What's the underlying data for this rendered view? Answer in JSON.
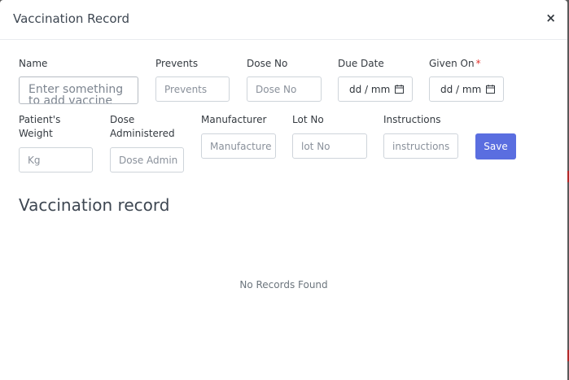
{
  "modal": {
    "title": "Vaccination Record",
    "close_label": "×"
  },
  "form": {
    "name": {
      "label": "Name",
      "placeholder": "Enter something to add vaccine"
    },
    "prevents": {
      "label": "Prevents",
      "placeholder": "Prevents"
    },
    "dose_no": {
      "label": "Dose No",
      "placeholder": "Dose No"
    },
    "due_date": {
      "label": "Due Date",
      "value": "dd / mm"
    },
    "given_on": {
      "label": "Given On",
      "required_mark": "*",
      "value": "dd / mm"
    },
    "patient_weight": {
      "label_line1": "Patient's",
      "label_line2": "Weight",
      "placeholder": "Kg"
    },
    "dose_administered": {
      "label_line1": "Dose",
      "label_line2": "Administered",
      "placeholder": "Dose Admin"
    },
    "manufacturer": {
      "label": "Manufacturer",
      "placeholder": "Manufacture"
    },
    "lot_no": {
      "label": "Lot No",
      "placeholder": "lot No"
    },
    "instructions": {
      "label": "Instructions",
      "placeholder": "instructions"
    },
    "save_label": "Save"
  },
  "records": {
    "title": "Vaccination record",
    "empty_text": "No Records Found"
  },
  "colors": {
    "primary": "#5a6ee0",
    "required": "#e3342f",
    "backdrop": "#5a5a5a"
  }
}
